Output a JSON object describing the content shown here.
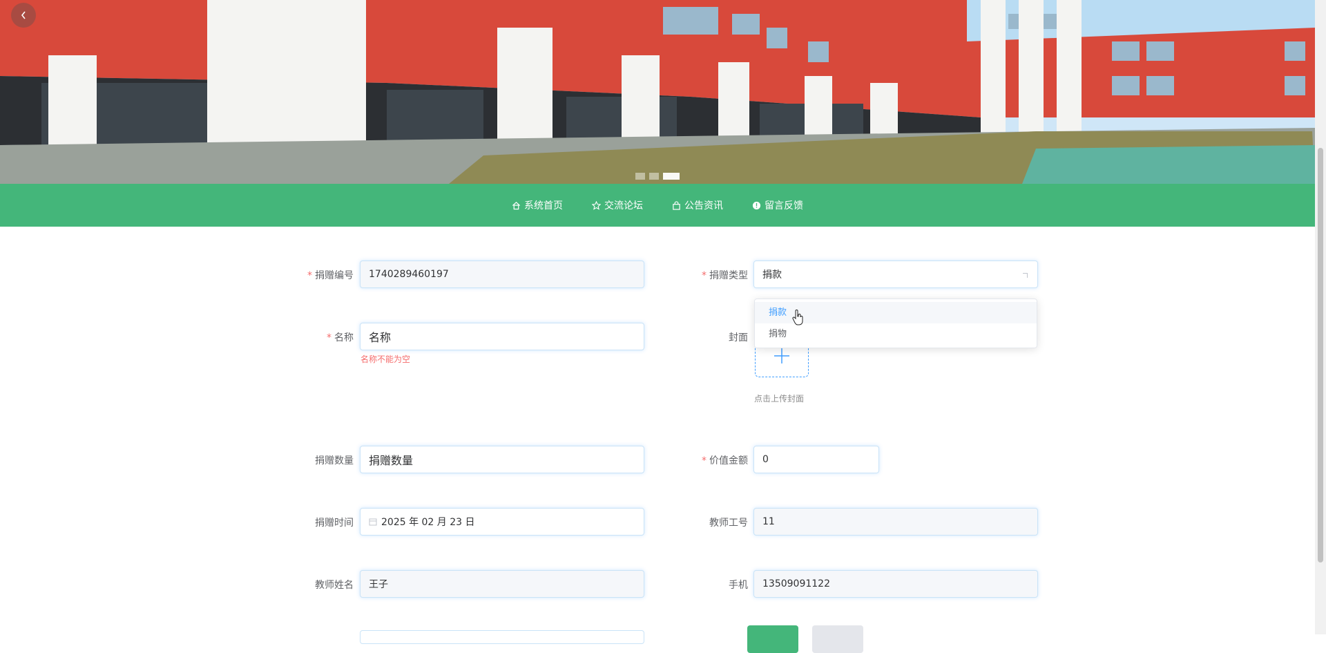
{
  "banner": {
    "back_icon": "chevron-left-icon",
    "slides": 3,
    "active_slide": 3
  },
  "nav": {
    "items": [
      {
        "label": "系统首页",
        "icon": "home-icon"
      },
      {
        "label": "交流论坛",
        "icon": "star-icon"
      },
      {
        "label": "公告资讯",
        "icon": "bag-icon"
      },
      {
        "label": "留言反馈",
        "icon": "info-icon"
      }
    ]
  },
  "form": {
    "donation_no": {
      "label": "捐赠编号",
      "value": "1740289460197"
    },
    "donation_type": {
      "label": "捐赠类型",
      "value": "捐款",
      "options": [
        "捐款",
        "捐物"
      ]
    },
    "name": {
      "label": "名称",
      "placeholder": "名称",
      "error": "名称不能为空"
    },
    "cover": {
      "label": "封面",
      "tip": "点击上传封面"
    },
    "quantity": {
      "label": "捐赠数量",
      "placeholder": "捐赠数量"
    },
    "amount": {
      "label": "价值金额",
      "value": "0"
    },
    "donation_time": {
      "label": "捐赠时间",
      "value": "2025 年 02 月 23 日"
    },
    "teacher_id": {
      "label": "教师工号",
      "value": "11"
    },
    "teacher_name": {
      "label": "教师姓名",
      "value": "王子"
    },
    "phone": {
      "label": "手机",
      "value": "13509091122"
    }
  },
  "colors": {
    "nav_bg": "#44b67a",
    "required": "#f56c6c",
    "accent": "#409eff"
  }
}
